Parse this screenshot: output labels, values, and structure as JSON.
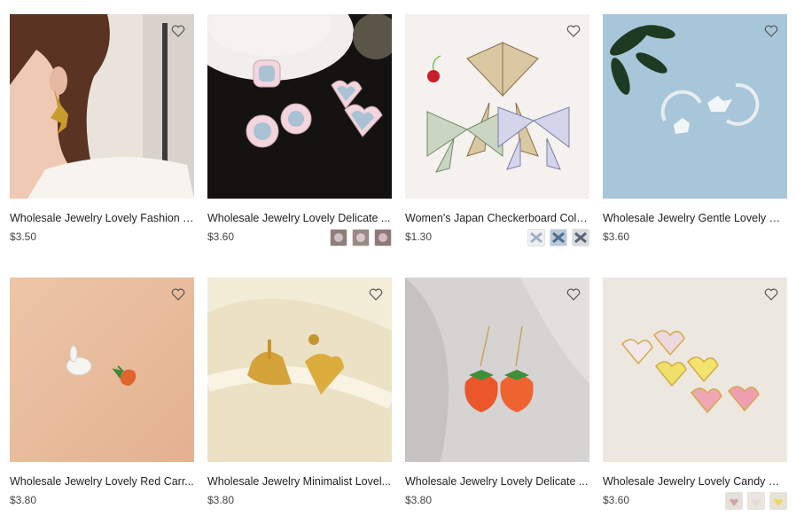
{
  "products": [
    {
      "title": "Wholesale Jewelry Lovely Fashion T...",
      "price": "$3.50"
    },
    {
      "title": "Wholesale Jewelry Lovely Delicate ...",
      "price": "$3.60"
    },
    {
      "title": "Women's Japan Checkerboard Color...",
      "price": "$1.30"
    },
    {
      "title": "Wholesale Jewelry Gentle Lovely Sil...",
      "price": "$3.60"
    },
    {
      "title": "Wholesale Jewelry Lovely Red Carr...",
      "price": "$3.80"
    },
    {
      "title": "Wholesale Jewelry Minimalist Lovel...",
      "price": "$3.80"
    },
    {
      "title": "Wholesale Jewelry Lovely Delicate ...",
      "price": "$3.80"
    },
    {
      "title": "Wholesale Jewelry Lovely Candy Re...",
      "price": "$3.60"
    }
  ],
  "icons": {
    "favorite": "heart-outline-icon"
  }
}
